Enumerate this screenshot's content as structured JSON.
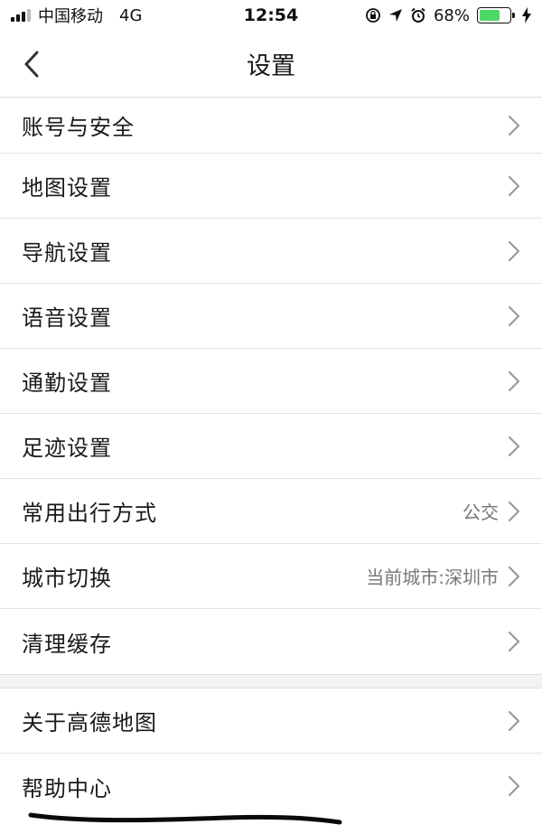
{
  "status_bar": {
    "carrier": "中国移动",
    "network": "4G",
    "time": "12:54",
    "battery": "68%",
    "battery_level": 0.68,
    "battery_color": "#4cd964",
    "icons": [
      "lock-rotation-icon",
      "location-arrow-icon",
      "alarm-icon",
      "charging-bolt-icon"
    ]
  },
  "nav": {
    "title": "设置",
    "back_icon": "chevron-left-icon"
  },
  "groups": [
    {
      "items": [
        {
          "label": "账号与安全",
          "value": ""
        },
        {
          "label": "地图设置",
          "value": ""
        },
        {
          "label": "导航设置",
          "value": ""
        },
        {
          "label": "语音设置",
          "value": ""
        },
        {
          "label": "通勤设置",
          "value": ""
        },
        {
          "label": "足迹设置",
          "value": ""
        },
        {
          "label": "常用出行方式",
          "value": "公交"
        },
        {
          "label": "城市切换",
          "value": "当前城市:深圳市"
        },
        {
          "label": "清理缓存",
          "value": ""
        }
      ]
    },
    {
      "items": [
        {
          "label": "关于高德地图",
          "value": ""
        },
        {
          "label": "帮助中心",
          "value": ""
        }
      ]
    }
  ]
}
